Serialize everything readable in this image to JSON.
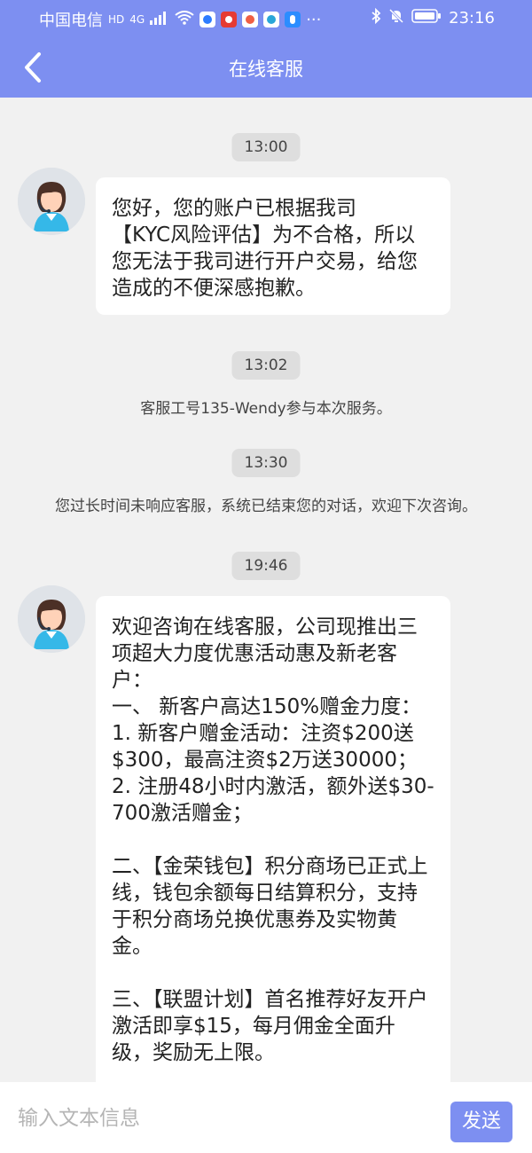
{
  "status_bar": {
    "carrier": "中国电信",
    "hd": "HD",
    "network": "4G",
    "time": "23:16",
    "icons": [
      "signal-icon",
      "wifi-icon",
      "shield-icon",
      "stock-app-icon",
      "news-app-icon",
      "browser-icon",
      "bulb-icon",
      "more-icon",
      "bluetooth-icon",
      "mute-icon",
      "battery-icon"
    ]
  },
  "header": {
    "title": "在线客服"
  },
  "chat": {
    "time_1": "13:00",
    "message_1": "您好，您的账户已根据我司\n【KYC风险评估】为不合格，所以您无法于我司进行开户交易，给您造成的不便深感抱歉。",
    "time_2": "13:02",
    "system_1": "客服工号135-Wendy参与本次服务。",
    "time_3": "13:30",
    "system_2": "您过长时间未响应客服，系统已结束您的对话，欢迎下次咨询。",
    "time_4": "19:46",
    "message_2": "欢迎咨询在线客服，公司现推出三项超大力度优惠活动惠及新老客户：\n一、 新客户高达150%赠金力度：\n1. 新客户赠金活动：注资$200送$300，最高注资$2万送30000；\n2. 注册48小时内激活，额外送$30-700激活赠金；\n\n二、【金荣钱包】积分商场已正式上线，钱包余额每日结算积分，支持于积分商场兑换优惠券及实物黄金。\n\n三、【联盟计划】首名推荐好友开户激活即享$15，每月佣金全面升级，奖励无上限。"
  },
  "input_bar": {
    "placeholder": "输入文本信息",
    "send_label": "发送"
  },
  "colors": {
    "header": "#7d8ff1",
    "background": "#f1f1f1",
    "bubble": "#ffffff",
    "time_badge": "#dedede"
  }
}
